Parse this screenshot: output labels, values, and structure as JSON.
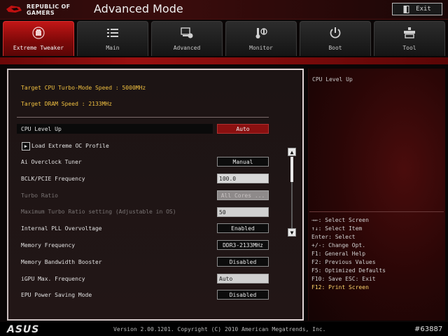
{
  "header": {
    "brand_line1": "REPUBLIC OF",
    "brand_line2": "GAMERS",
    "mode_title": "Advanced Mode",
    "exit_label": "Exit"
  },
  "tabs": [
    {
      "label": "Extreme Tweaker",
      "icon": "tweaker-icon",
      "active": true
    },
    {
      "label": "Main",
      "icon": "list-icon",
      "active": false
    },
    {
      "label": "Advanced",
      "icon": "advanced-icon",
      "active": false
    },
    {
      "label": "Monitor",
      "icon": "monitor-icon",
      "active": false
    },
    {
      "label": "Boot",
      "icon": "power-icon",
      "active": false
    },
    {
      "label": "Tool",
      "icon": "tool-icon",
      "active": false
    }
  ],
  "targets": {
    "cpu_turbo": "Target CPU Turbo-Mode Speed : 5000MHz",
    "dram": "Target DRAM Speed : 2133MHz"
  },
  "settings": {
    "cpu_level_up": {
      "label": "CPU Level Up",
      "value": "Auto"
    },
    "load_oc_profile": {
      "label": "Load Extreme OC Profile"
    },
    "ai_overclock": {
      "label": "Ai Overclock Tuner",
      "value": "Manual"
    },
    "bclk": {
      "label": "BCLK/PCIE Frequency",
      "value": "100.0"
    },
    "turbo_ratio": {
      "label": "Turbo Ratio",
      "value": "All Cores ..."
    },
    "max_turbo": {
      "label": "Maximum Turbo Ratio setting (Adjustable in OS)",
      "value": "50"
    },
    "pll": {
      "label": "Internal PLL Overvoltage",
      "value": "Enabled"
    },
    "mem_freq": {
      "label": "Memory Frequency",
      "value": "DDR3-2133MHz"
    },
    "mem_bw": {
      "label": "Memory Bandwidth Booster",
      "value": "Disabled"
    },
    "igpu": {
      "label": "iGPU Max. Frequency",
      "value": "Auto"
    },
    "epu": {
      "label": "EPU Power Saving Mode",
      "value": "Disabled"
    }
  },
  "help": {
    "title": "CPU Level Up",
    "lines": [
      "→←: Select Screen",
      "↑↓: Select Item",
      "Enter: Select",
      "+/-: Change Opt.",
      "F1: General Help",
      "F2: Previous Values",
      "F5: Optimized Defaults",
      "F10: Save  ESC: Exit",
      "F12: Print Screen"
    ]
  },
  "footer": {
    "brand": "ASUS",
    "version": "Version 2.00.1201. Copyright (C) 2010 American Megatrends, Inc.",
    "image_number": "#63887"
  },
  "colors": {
    "accent_red": "#c21616",
    "target_text": "#f0c040",
    "print_screen": "#ffd46a"
  }
}
